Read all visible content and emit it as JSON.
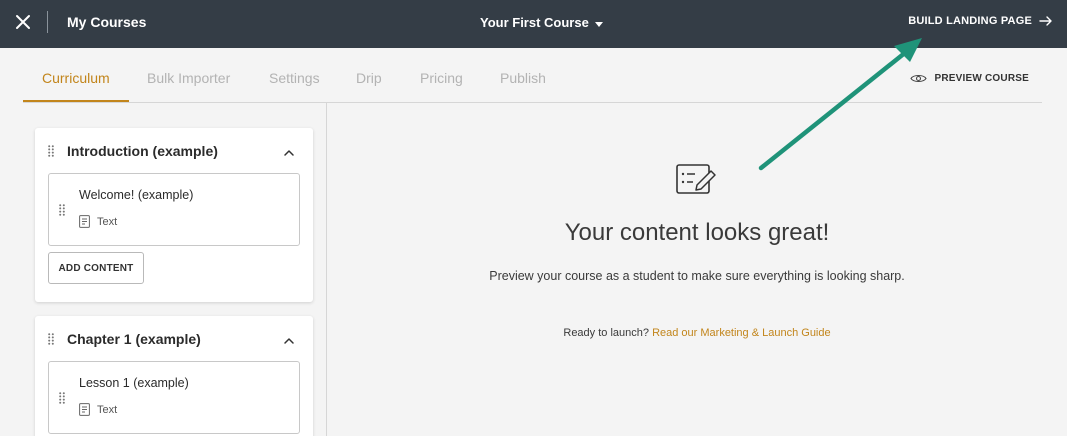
{
  "topbar": {
    "close_icon": "close-icon",
    "title": "My Courses",
    "course_select": "Your First Course",
    "build_landing": "BUILD LANDING PAGE",
    "arrow_icon": "arrow-right-icon"
  },
  "tabs": [
    {
      "label": "Curriculum",
      "active": true
    },
    {
      "label": "Bulk Importer"
    },
    {
      "label": "Settings"
    },
    {
      "label": "Drip"
    },
    {
      "label": "Pricing"
    },
    {
      "label": "Publish"
    }
  ],
  "preview_course": "PREVIEW COURSE",
  "sections": [
    {
      "title": "Introduction (example)",
      "lesson": {
        "title": "Welcome! (example)",
        "type": "Text"
      },
      "add_content": "ADD CONTENT"
    },
    {
      "title": "Chapter 1 (example)",
      "lesson": {
        "title": "Lesson 1 (example)",
        "type": "Text"
      }
    }
  ],
  "main": {
    "heading": "Your content looks great!",
    "subtext": "Preview your course as a student to make sure everything is looking sharp.",
    "ready_text": "Ready to launch?",
    "guide_link": "Read our Marketing & Launch Guide"
  },
  "colors": {
    "topbar": "#343d46",
    "accent": "#c2851b",
    "annotation_arrow": "#1f9379"
  }
}
